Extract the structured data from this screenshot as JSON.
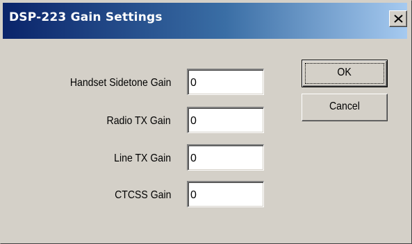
{
  "window": {
    "title": "DSP-223 Gain Settings",
    "close_glyph": "×"
  },
  "fields": [
    {
      "label": "Handset Sidetone Gain",
      "value": "0"
    },
    {
      "label": "Radio TX Gain",
      "value": "0"
    },
    {
      "label": "Line TX Gain",
      "value": "0"
    },
    {
      "label": "CTCSS Gain",
      "value": "0"
    }
  ],
  "buttons": {
    "ok_label": "OK",
    "cancel_label": "Cancel"
  },
  "colors": {
    "titlebar_start": "#0a246a",
    "titlebar_end": "#a6caf0",
    "dialog_face": "#d4d0c8"
  },
  "icons": {
    "close": "close-icon"
  }
}
